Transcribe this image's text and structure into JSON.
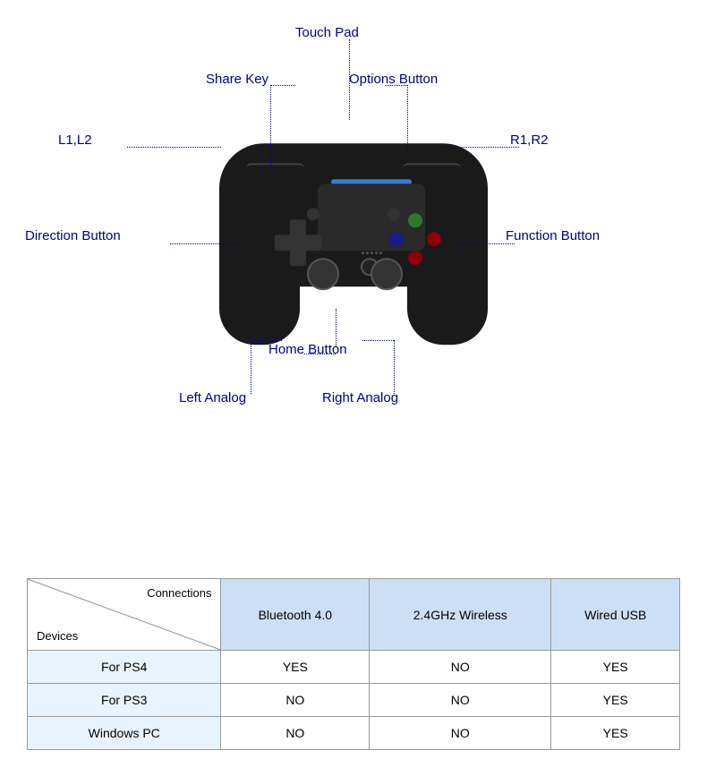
{
  "diagram": {
    "labels": {
      "touch_pad": "Touch Pad",
      "share_key": "Share Key",
      "options_button": "Options Button",
      "l1_l2": "L1,L2",
      "r1_r2": "R1,R2",
      "direction_button": "Direction Button",
      "function_button": "Function Button",
      "home_button": "Home Button",
      "left_analog": "Left Analog",
      "right_analog": "Right Analog"
    }
  },
  "table": {
    "header_connections": "Connections",
    "header_devices": "Devices",
    "col1": "Bluetooth 4.0",
    "col2": "2.4GHz Wireless",
    "col3": "Wired USB",
    "rows": [
      {
        "device": "For PS4",
        "col1": "YES",
        "col2": "NO",
        "col3": "YES"
      },
      {
        "device": "For PS3",
        "col1": "NO",
        "col2": "NO",
        "col3": "YES"
      },
      {
        "device": "Windows PC",
        "col1": "NO",
        "col2": "NO",
        "col3": "YES"
      }
    ]
  }
}
